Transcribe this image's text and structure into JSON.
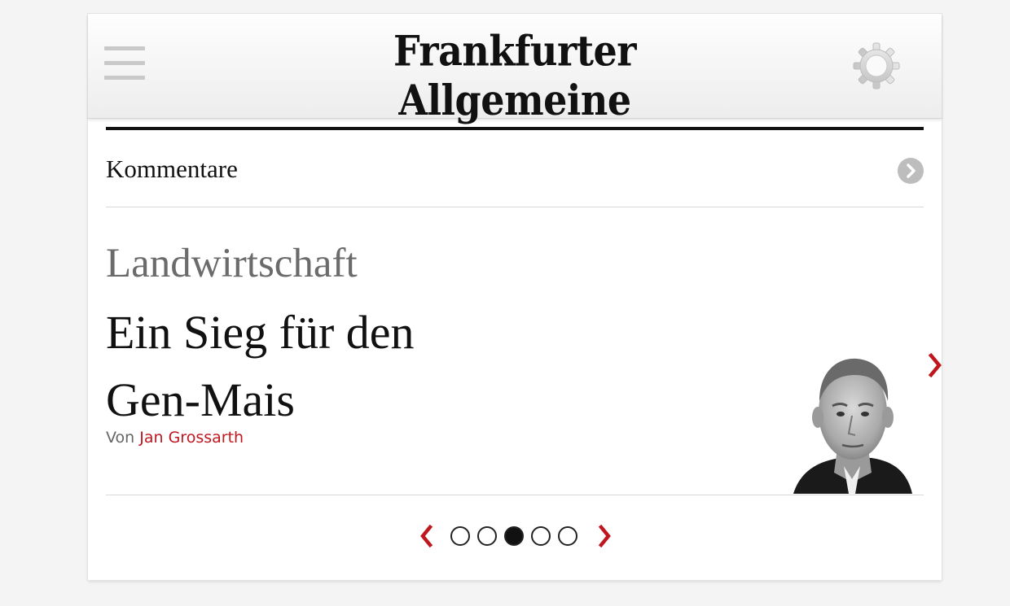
{
  "header": {
    "logo_text": "Frankfurter Allgemeine",
    "menu_icon": "hamburger-menu-icon",
    "settings_icon": "gear-icon"
  },
  "section": {
    "title": "Kommentare",
    "arrow_icon": "chevron-right-circle-icon"
  },
  "article": {
    "kicker": "Landwirtschaft",
    "headline_line1": "Ein Sieg für den",
    "headline_line2": "Gen-Mais",
    "byline_prefix": "Von",
    "author": "Jan Grossarth",
    "image": "author-portrait",
    "next_icon": "chevron-right-icon"
  },
  "pager": {
    "pages_total": 5,
    "active_page": 3,
    "prev_icon": "chevron-left-icon",
    "next_icon": "chevron-right-icon"
  },
  "colors": {
    "accent_red": "#c0171f",
    "kicker_gray": "#6b6b6b",
    "text": "#111111"
  }
}
